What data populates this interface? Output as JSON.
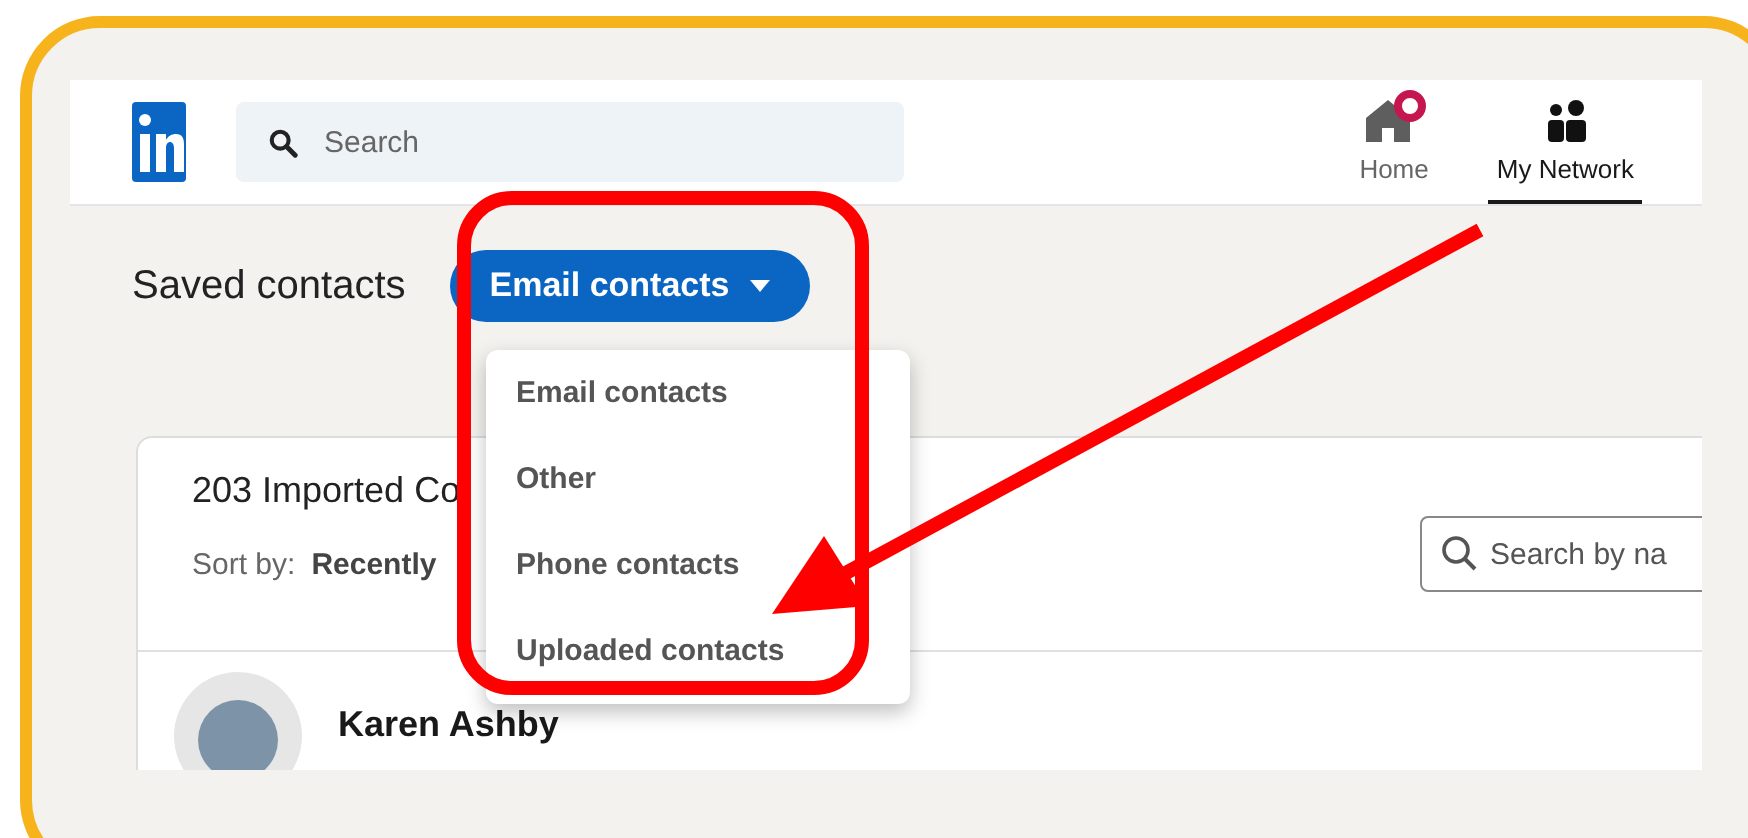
{
  "header": {
    "search": {
      "placeholder": "Search"
    },
    "nav": [
      {
        "kind": "home",
        "label": "Home",
        "selected": false
      },
      {
        "kind": "network",
        "label": "My Network",
        "selected": true
      }
    ]
  },
  "page_title": "Saved contacts",
  "filter_button": {
    "label": "Email contacts"
  },
  "dropdown": {
    "items": [
      "Email contacts",
      "Other",
      "Phone contacts",
      "Uploaded contacts"
    ]
  },
  "card": {
    "title": "203 Imported Co",
    "sort_label": "Sort by:",
    "sort_value": "Recently",
    "search": {
      "placeholder": "Search by na"
    },
    "contacts": [
      {
        "name": "Karen Ashby"
      }
    ]
  }
}
